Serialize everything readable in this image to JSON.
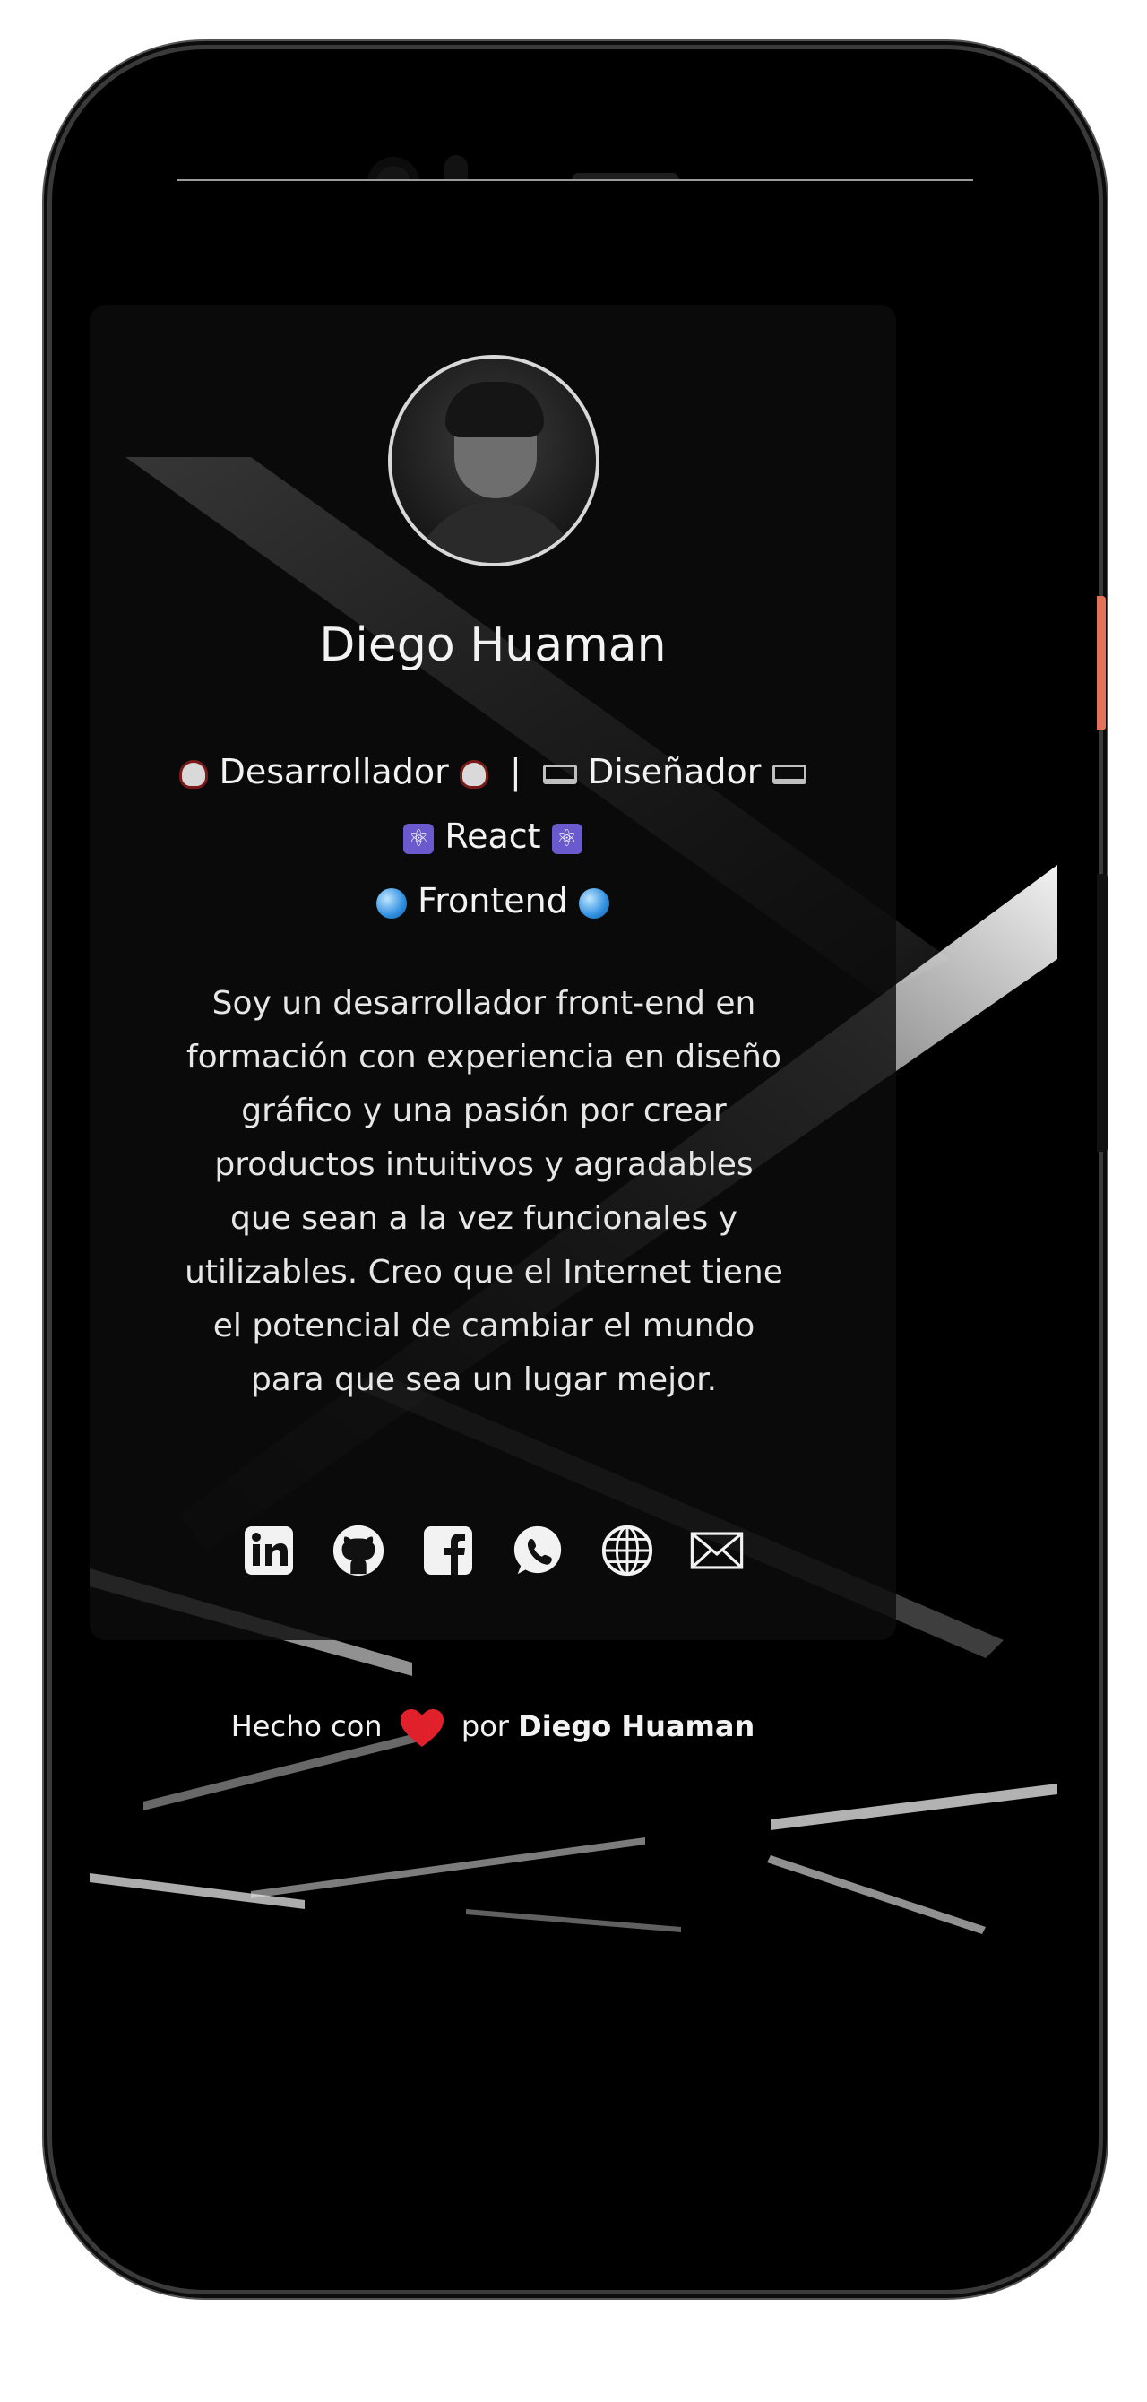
{
  "profile": {
    "name": "Diego Huaman",
    "roles": {
      "line1_a": "Desarrollador",
      "separator": "|",
      "line1_b": "Diseñador",
      "line2": "React",
      "line3": "Frontend"
    },
    "bio": "Soy un desarrollador front-end en formación con experiencia en diseño gráfico y una pasión por crear productos intuitivos y agradables que sean a la vez funcionales y utilizables. Creo que el Internet tiene el potencial de cambiar el mundo para que sea un lugar mejor."
  },
  "socials": [
    {
      "icon": "linkedin-icon"
    },
    {
      "icon": "github-icon"
    },
    {
      "icon": "facebook-icon"
    },
    {
      "icon": "whatsapp-icon"
    },
    {
      "icon": "globe-icon"
    },
    {
      "icon": "mail-icon"
    }
  ],
  "footer": {
    "made_with": "Hecho con",
    "by": "por",
    "author": "Diego Huaman"
  },
  "colors": {
    "background": "#000000",
    "text": "#f2f2f2",
    "heart": "#e0202a",
    "phone_button_accent": "#e2735a"
  }
}
